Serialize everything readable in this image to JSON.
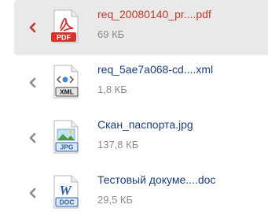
{
  "files": [
    {
      "name": "req_20080140_pr....pdf",
      "size": "69 КБ",
      "type_label": "PDF",
      "icon": "pdf-icon",
      "selected": true
    },
    {
      "name": "req_5ae7a068-cd....xml",
      "size": "1,8 КБ",
      "type_label": "XML",
      "icon": "xml-icon",
      "selected": false
    },
    {
      "name": "Скан_паспорта.jpg",
      "size": "137,8 КБ",
      "type_label": "JPG",
      "icon": "jpg-icon",
      "selected": false
    },
    {
      "name": "Тестовый докуме....doc",
      "size": "29,5 КБ",
      "type_label": "DOC",
      "icon": "doc-icon",
      "selected": false
    }
  ],
  "colors": {
    "selected_bg": "#e9e9e9",
    "selected_text": "#c0392b",
    "link_text": "#1a3f7a",
    "muted_text": "#8a8a8a",
    "chevron_active": "#c0392b",
    "chevron_inactive": "#8a8a8a"
  }
}
